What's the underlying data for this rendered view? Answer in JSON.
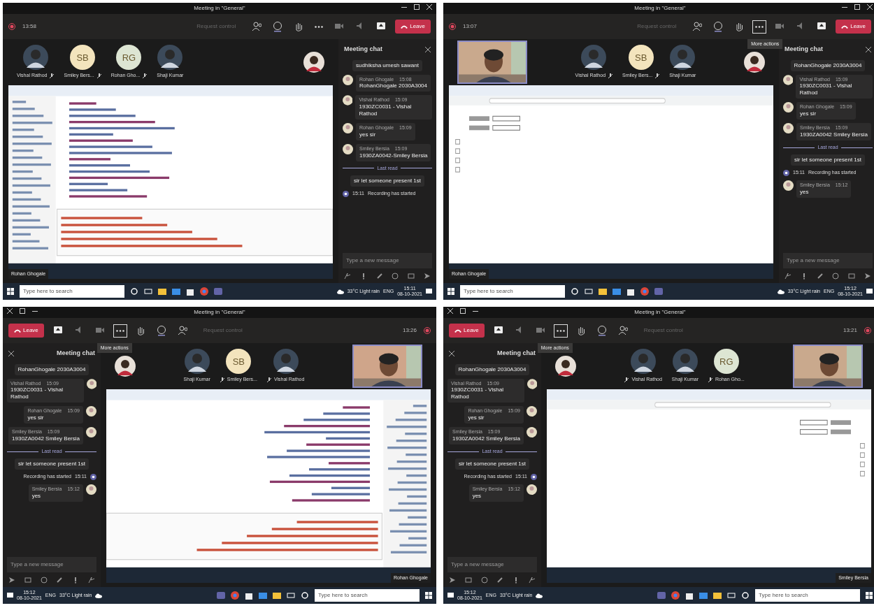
{
  "panels": [
    {
      "mirrored": false,
      "window_title": "Meeting in \"General\"",
      "timer": "13:58",
      "request_control": "Request control",
      "leave_label": "Leave",
      "more_focused": false,
      "self_video": false,
      "participants": [
        {
          "name": "Vishal Rathod",
          "muted": true
        },
        {
          "kind": "initials",
          "initials": "SB",
          "color": "#f3e4bd",
          "name": "Smiley Bers...",
          "muted": true
        },
        {
          "kind": "initials",
          "initials": "RG",
          "color": "#dde5d3",
          "name": "Rohan Gho...",
          "muted": true
        },
        {
          "name": "Shaji Kumar",
          "muted": false
        }
      ],
      "screen": {
        "kind": "ide",
        "presenter": "Rohan Ghogale"
      },
      "chat": {
        "title": "Meeting chat",
        "placeholder": "Type a new message",
        "messages": [
          {
            "kind": "bubble",
            "text": "sudhiksha umesh sawant"
          },
          {
            "kind": "message",
            "author": "Rohan Ghogale",
            "time": "15:08",
            "text": "RohanGhogale 2030A3004"
          },
          {
            "kind": "message",
            "author": "Vishal Rathod",
            "time": "15:09",
            "text": "1930ZC0031 - Vishal Rathod"
          },
          {
            "kind": "message",
            "author": "Rohan Ghogale",
            "time": "15:09",
            "text": "yes sir"
          },
          {
            "kind": "message",
            "author": "Smiley Bersia",
            "time": "15:09",
            "text": "1930ZA0042-Smiley Bersia"
          },
          {
            "kind": "divider",
            "text": "Last read"
          },
          {
            "kind": "bubble",
            "text": "sir let someone present 1st"
          },
          {
            "kind": "system",
            "time": "15:11",
            "text": "Recording has started"
          }
        ]
      },
      "taskbar": {
        "search_placeholder": "Type here to search",
        "weather": "33°C Light rain",
        "language": "ENG",
        "time": "15:11",
        "date": "08-10-2021"
      }
    },
    {
      "mirrored": false,
      "window_title": "Meeting in \"General\"",
      "timer": "13:07",
      "request_control": "Request control",
      "leave_label": "Leave",
      "more_focused": true,
      "tooltip": "More actions",
      "self_video": true,
      "participants": [
        {
          "name": "Vishal Rathod",
          "muted": true
        },
        {
          "kind": "initials",
          "initials": "SB",
          "color": "#f3e4bd",
          "name": "Smiley Bers...",
          "muted": true
        },
        {
          "name": "Shaji Kumar",
          "muted": false
        }
      ],
      "screen": {
        "kind": "browser",
        "presenter": "Rohan Ghogale"
      },
      "chat": {
        "title": "Meeting chat",
        "placeholder": "Type a new message",
        "messages": [
          {
            "kind": "bubble",
            "text": "RohanGhogale 2030A3004"
          },
          {
            "kind": "message",
            "author": "Vishal Rathod",
            "time": "15:09",
            "text": "1930ZC0031 - Vishal Rathod"
          },
          {
            "kind": "message",
            "author": "Rohan Ghogale",
            "time": "15:09",
            "text": "yes sir"
          },
          {
            "kind": "message",
            "author": "Smiley Bersia",
            "time": "15:09",
            "text": "1930ZA0042 Smiley Bersia"
          },
          {
            "kind": "divider",
            "text": "Last read"
          },
          {
            "kind": "bubble",
            "text": "sir let someone present 1st"
          },
          {
            "kind": "system",
            "time": "15:11",
            "text": "Recording has started"
          },
          {
            "kind": "message",
            "author": "Smiley Bersia",
            "time": "15:12",
            "text": "yes"
          }
        ]
      },
      "taskbar": {
        "search_placeholder": "Type here to search",
        "weather": "33°C Light rain",
        "language": "ENG",
        "time": "15:12",
        "date": "08-10-2021"
      }
    },
    {
      "mirrored": true,
      "window_title": "Meeting in \"General\"",
      "timer": "13:26",
      "request_control": "Request control",
      "leave_label": "Leave",
      "more_focused": true,
      "tooltip": "More actions",
      "self_video": true,
      "participants": [
        {
          "name": "Shaji Kumar",
          "muted": false
        },
        {
          "kind": "initials",
          "initials": "SB",
          "color": "#f3e4bd",
          "name": "Smiley Bers...",
          "muted": true
        },
        {
          "name": "Vishal Rathod",
          "muted": true
        }
      ],
      "screen": {
        "kind": "ide",
        "presenter": "Rohan Ghogale"
      },
      "chat": {
        "title": "Meeting chat",
        "placeholder": "Type a new message",
        "messages": [
          {
            "kind": "bubble",
            "text": "RohanGhogale 2030A3004"
          },
          {
            "kind": "message",
            "author": "Vishal Rathod",
            "time": "15:09",
            "text": "1930ZC0031 - Vishal Rathod"
          },
          {
            "kind": "message",
            "author": "Rohan Ghogale",
            "time": "15:09",
            "text": "yes sir"
          },
          {
            "kind": "message",
            "author": "Smiley Bersia",
            "time": "15:09",
            "text": "1930ZA0042 Smiley Bersia"
          },
          {
            "kind": "divider",
            "text": "Last read"
          },
          {
            "kind": "bubble",
            "text": "sir let someone present 1st"
          },
          {
            "kind": "system",
            "time": "15:11",
            "text": "Recording has started"
          },
          {
            "kind": "message",
            "author": "Smiley Bersia",
            "time": "15:12",
            "text": "yes"
          }
        ]
      },
      "taskbar": {
        "search_placeholder": "Type here to search",
        "weather": "33°C Light rain",
        "language": "ENG",
        "time": "15:12",
        "date": "08-10-2021"
      }
    },
    {
      "mirrored": true,
      "window_title": "Meeting in \"General\"",
      "timer": "13:21",
      "request_control": "Request control",
      "leave_label": "Leave",
      "more_focused": true,
      "tooltip": "More actions",
      "self_video": true,
      "participants": [
        {
          "name": "Vishal Rathod",
          "muted": true
        },
        {
          "name": "Shaji Kumar",
          "muted": false
        },
        {
          "kind": "initials",
          "initials": "RG",
          "color": "#dde5d3",
          "name": "Rohan Gho...",
          "muted": true
        }
      ],
      "screen": {
        "kind": "browser",
        "presenter": "Smiley Bersia"
      },
      "chat": {
        "title": "Meeting chat",
        "placeholder": "Type a new message",
        "messages": [
          {
            "kind": "bubble",
            "text": "RohanGhogale 2030A3004"
          },
          {
            "kind": "message",
            "author": "Vishal Rathod",
            "time": "15:09",
            "text": "1930ZC0031 - Vishal Rathod"
          },
          {
            "kind": "message",
            "author": "Rohan Ghogale",
            "time": "15:09",
            "text": "yes sir"
          },
          {
            "kind": "message",
            "author": "Smiley Bersia",
            "time": "15:09",
            "text": "1930ZA0042 Smiley Bersia"
          },
          {
            "kind": "divider",
            "text": "Last read"
          },
          {
            "kind": "bubble",
            "text": "sir let someone present 1st"
          },
          {
            "kind": "system",
            "time": "15:11",
            "text": "Recording has started"
          },
          {
            "kind": "message",
            "author": "Smiley Bersia",
            "time": "15:12",
            "text": "yes"
          }
        ]
      },
      "taskbar": {
        "search_placeholder": "Type here to search",
        "weather": "33°C Light rain",
        "language": "ENG",
        "time": "15:12",
        "date": "08-10-2021"
      }
    }
  ]
}
